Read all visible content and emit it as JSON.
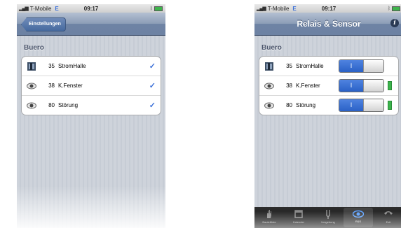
{
  "left_screen": {
    "status_bar": {
      "carrier": "T-Mobile",
      "network": "E",
      "time": "09:17"
    },
    "nav": {
      "back_label": "Einstellungen"
    },
    "section_header": "Buero",
    "rows": [
      {
        "num": "35",
        "name": "StromHalle",
        "icon": "relay-icon",
        "checked": true
      },
      {
        "num": "38",
        "name": "K.Fenster",
        "icon": "eye-icon",
        "checked": true
      },
      {
        "num": "80",
        "name": "Störung",
        "icon": "eye-icon",
        "checked": true
      }
    ],
    "check_glyph": "✓"
  },
  "right_screen": {
    "status_bar": {
      "carrier": "T-Mobile",
      "network": "E",
      "time": "09:17"
    },
    "nav": {
      "title": "Relais & Sensor",
      "info_glyph": "i"
    },
    "section_header": "Buero",
    "rows": [
      {
        "num": "35",
        "name": "StromHalle",
        "icon": "relay-icon",
        "switch_on": true,
        "sensor_led": false
      },
      {
        "num": "38",
        "name": "K.Fenster",
        "icon": "eye-icon",
        "switch_on": true,
        "sensor_led": true
      },
      {
        "num": "80",
        "name": "Störung",
        "icon": "eye-icon",
        "switch_on": true,
        "sensor_led": true
      }
    ],
    "switch_on_glyph": "I",
    "tab_bar": [
      {
        "label": "Bauteilliste",
        "icon": "hand-icon",
        "active": false
      },
      {
        "label": "Kalender",
        "icon": "calendar-icon",
        "active": false
      },
      {
        "label": "Umgebung",
        "icon": "plug-icon",
        "active": false
      },
      {
        "label": "R&S",
        "icon": "eye-icon",
        "active": true
      },
      {
        "label": "Exit",
        "icon": "phone-icon",
        "active": false
      }
    ]
  },
  "colors": {
    "accent": "#3a6fd8",
    "nav_bar": "#7f91ad",
    "led_on": "#3cb44c"
  }
}
